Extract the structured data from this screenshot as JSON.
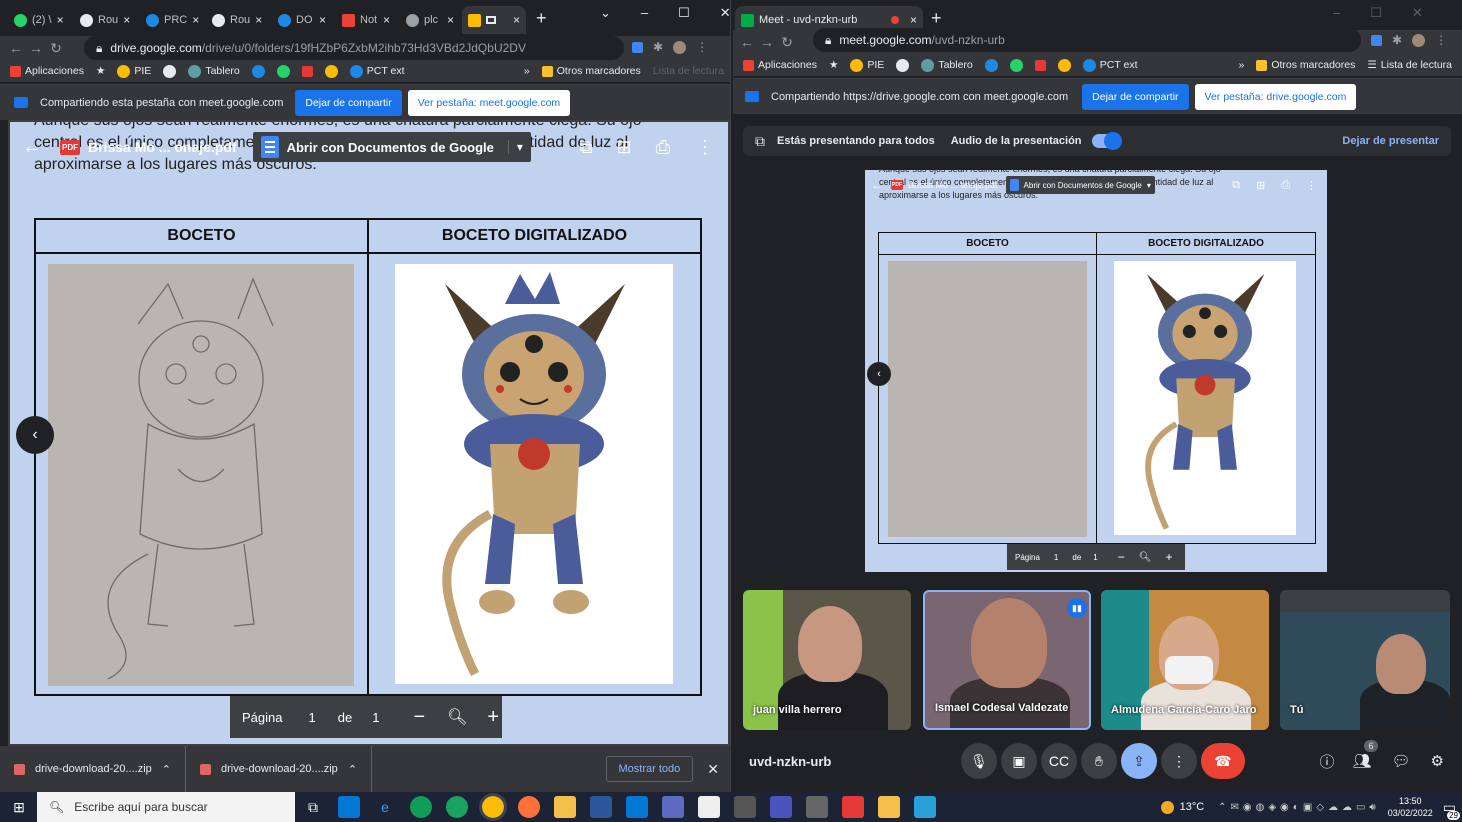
{
  "left_window": {
    "tabs": [
      {
        "label": "(2) \\",
        "icon": "whatsapp-icon",
        "color": "#25d366"
      },
      {
        "label": "Rou",
        "icon": "routine-icon",
        "color": "#e8eaed"
      },
      {
        "label": "PRC",
        "icon": "onedrive-icon",
        "color": "#1e88e5"
      },
      {
        "label": "Rou",
        "icon": "routine-icon",
        "color": "#e8eaed"
      },
      {
        "label": "DO",
        "icon": "onedrive-icon",
        "color": "#1e88e5"
      },
      {
        "label": "Not",
        "icon": "gmail-icon",
        "color": "#ea4335"
      },
      {
        "label": "plc",
        "icon": "github-icon",
        "color": "#9aa0a6"
      },
      {
        "label": "",
        "icon": "drive-icon",
        "color": "#fbbc04"
      }
    ],
    "url": "drive.google.com",
    "url_path": "/drive/u/0/folders/19fHZbP6ZxbM2ihb73Hd3VBd2JdQbU2DV",
    "bookmarks": [
      "Aplicaciones",
      "PIE",
      "Tablero",
      "PCT ext"
    ],
    "bookmarks_other": "Otros marcadores",
    "bookmarks_reading": "Lista de lectura",
    "share_text": "Compartiendo esta pestaña con meet.google.com",
    "share_stop": "Dejar de compartir",
    "share_view": "Ver pestaña: meet.google.com",
    "viewer": {
      "filename": "Brissa Mo ... onaje.pdf",
      "open_with": "Abrir con Documentos de Google",
      "bg_text_1": "Aunque sus ojos sean realmente enormes, es una criatura parcialmente ciega. Su ojo",
      "bg_text_2": "central es el único completamente funcional y emite una pequeña cantidad de luz al",
      "bg_text_3": "aproximarse a los lugares más oscuros.",
      "col1": "BOCETO",
      "col2": "BOCETO DIGITALIZADO",
      "page_label": "Página",
      "page_num": "1",
      "page_of": "de",
      "page_total": "1"
    },
    "downloads": [
      "drive-download-20....zip",
      "drive-download-20....zip"
    ],
    "show_all": "Mostrar todo"
  },
  "right_window": {
    "tab_title": "Meet - uvd-nzkn-urb",
    "url": "meet.google.com",
    "url_path": "/uvd-nzkn-urb",
    "bookmarks": [
      "Aplicaciones",
      "PIE",
      "Tablero",
      "PCT ext"
    ],
    "bookmarks_other": "Otros marcadores",
    "bookmarks_reading": "Lista de lectura",
    "share_text": "Compartiendo https://drive.google.com con meet.google.com",
    "share_stop": "Dejar de compartir",
    "share_view": "Ver pestaña: drive.google.com",
    "presenting": "Estás presentando para todos",
    "audio": "Audio de la presentación",
    "stop_presenting": "Dejar de presentar",
    "participants": [
      {
        "name": "juan villa herrero",
        "bg": "#5a5648"
      },
      {
        "name": "Ismael Codesal Valdezate",
        "bg": "#7a6670"
      },
      {
        "name": "Almudena García-Caro Jaro",
        "bg": "#c58a42"
      },
      {
        "name": "Tú",
        "bg": "#2f4a58"
      }
    ],
    "meeting_code": "uvd-nzkn-urb",
    "people_count": "6"
  },
  "taskbar": {
    "search_placeholder": "Escribe aquí para buscar",
    "weather": "13°C",
    "time": "13:50",
    "date": "03/02/2022",
    "notifications": "29"
  }
}
